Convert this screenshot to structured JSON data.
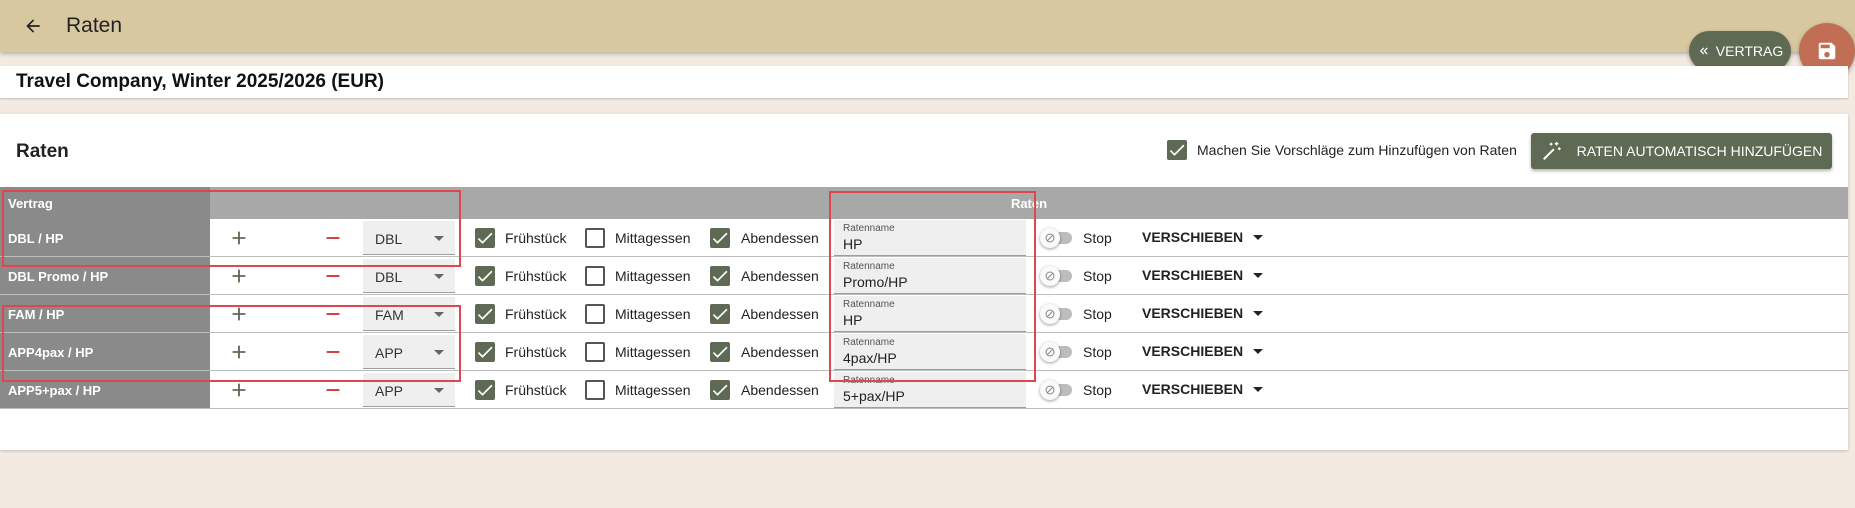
{
  "appbar": {
    "title": "Raten"
  },
  "fab": {
    "vertrag_label": "VERTRAG"
  },
  "subheader": {
    "title": "Travel Company, Winter 2025/2026 (EUR)"
  },
  "card": {
    "title": "Raten",
    "suggest_label": "Machen Sie Vorschläge zum Hinzufügen von Raten",
    "suggest_checked": true,
    "auto_button_label": "RATEN AUTOMATISCH HINZUFÜGEN"
  },
  "table": {
    "col_vertrag": "Vertrag",
    "col_raten": "Raten",
    "labels": {
      "breakfast": "Frühstück",
      "lunch": "Mittagessen",
      "dinner": "Abendessen",
      "rate_name": "Ratenname",
      "stop": "Stop",
      "move": "VERSCHIEBEN"
    },
    "rows": [
      {
        "vertrag": "DBL / HP",
        "room": "DBL",
        "breakfast": true,
        "lunch": false,
        "dinner": true,
        "rate_name": "HP",
        "stop": false
      },
      {
        "vertrag": "DBL Promo / HP",
        "room": "DBL",
        "breakfast": true,
        "lunch": false,
        "dinner": true,
        "rate_name": "Promo/HP",
        "stop": false
      },
      {
        "vertrag": "FAM / HP",
        "room": "FAM",
        "breakfast": true,
        "lunch": false,
        "dinner": true,
        "rate_name": "HP",
        "stop": false
      },
      {
        "vertrag": "APP4pax / HP",
        "room": "APP",
        "breakfast": true,
        "lunch": false,
        "dinner": true,
        "rate_name": "4pax/HP",
        "stop": false
      },
      {
        "vertrag": "APP5+pax / HP",
        "room": "APP",
        "breakfast": true,
        "lunch": false,
        "dinner": true,
        "rate_name": "5+pax/HP",
        "stop": false
      }
    ]
  },
  "colors": {
    "appbar": "#d7c8a0",
    "accent_green": "#5f6a55",
    "save_fab": "#c26e55",
    "highlight": "#e0464f",
    "background": "#f3ebe2"
  }
}
